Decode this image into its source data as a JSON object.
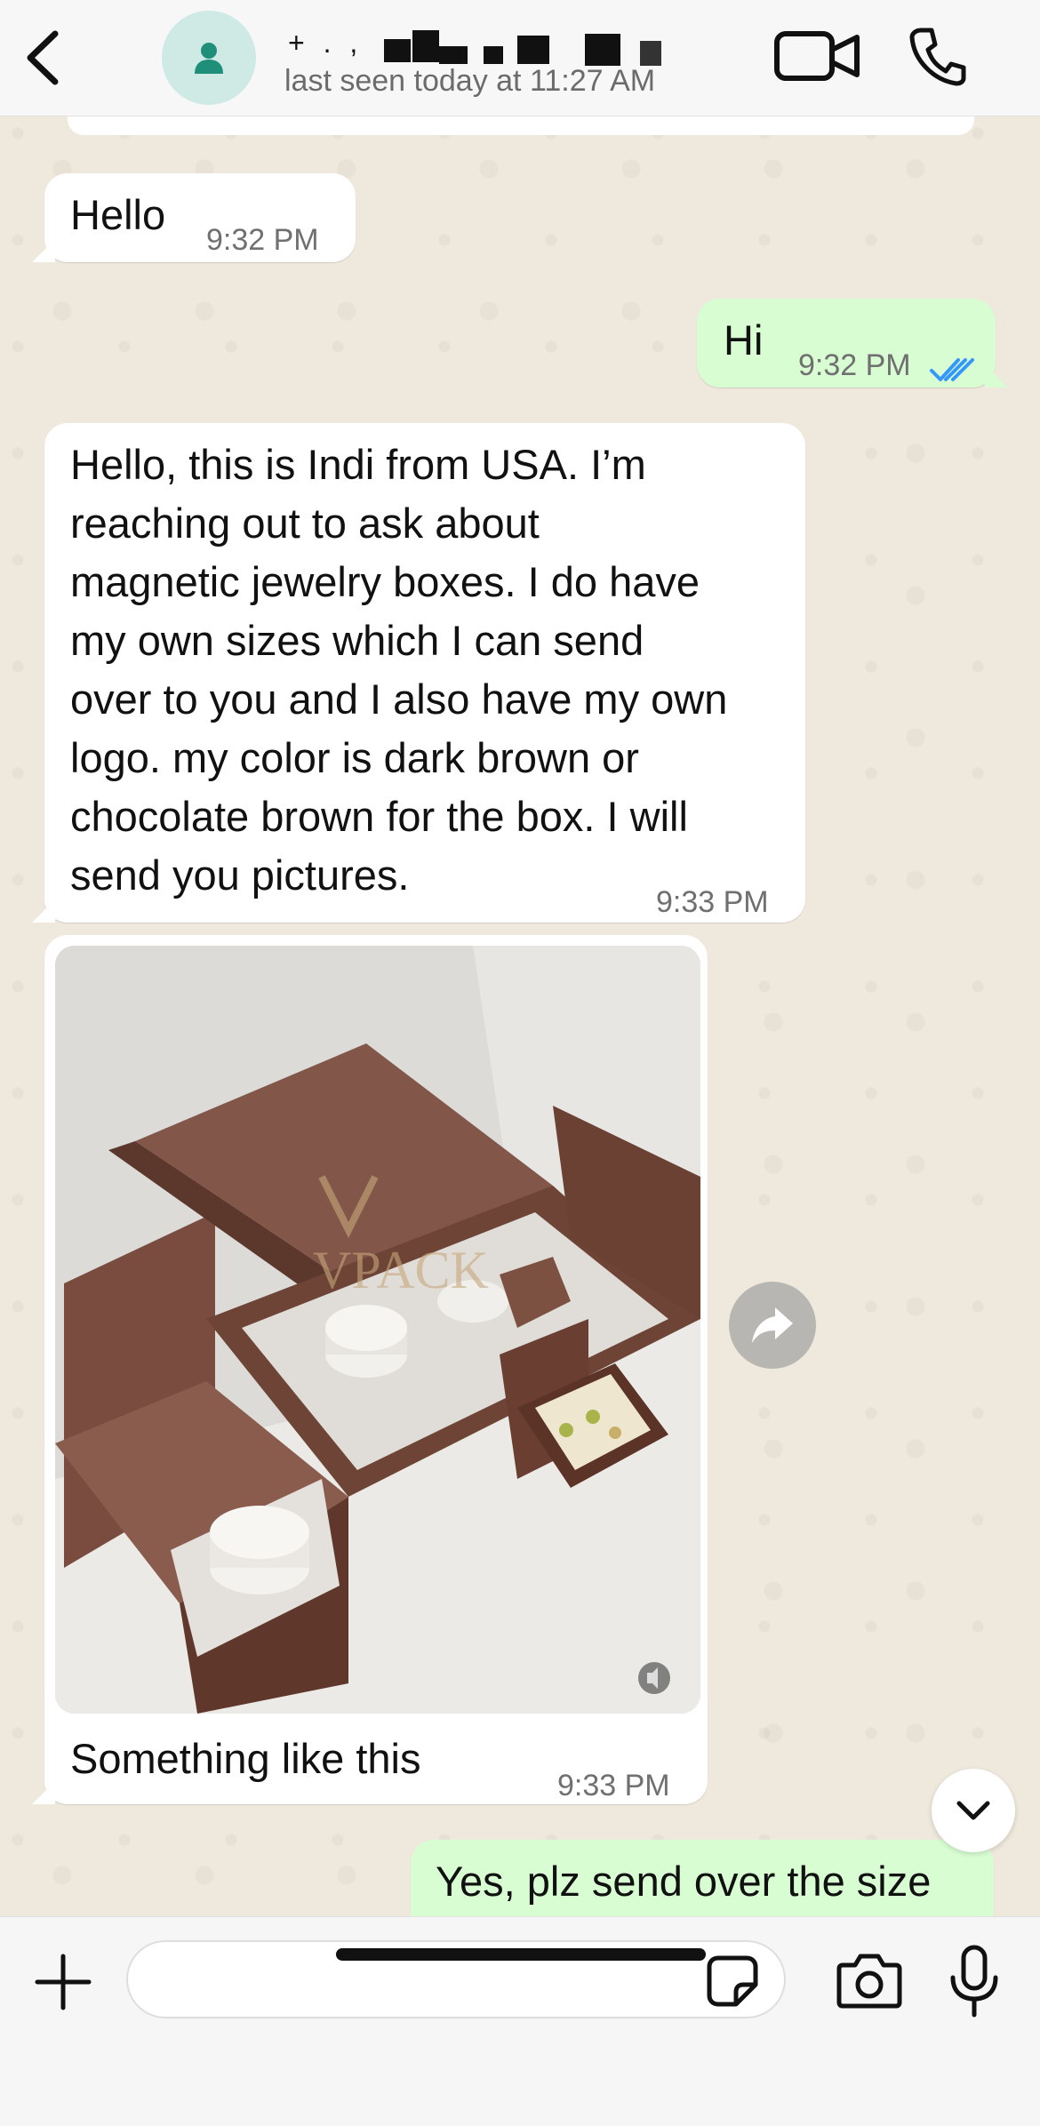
{
  "header": {
    "contact_name": "+ . ,",
    "last_seen": "last seen today at 11:27 AM",
    "icons": [
      "back-chevron-icon",
      "contact-avatar-icon",
      "video-call-icon",
      "voice-call-icon"
    ]
  },
  "messages": [
    {
      "direction": "incoming",
      "text": "Hello",
      "time": "9:32 PM"
    },
    {
      "direction": "outgoing",
      "text": "Hi",
      "time": "9:32 PM",
      "status": "read"
    },
    {
      "direction": "incoming",
      "text": "Hello, this is Indi from USA. I’m\nreaching out to ask about\nmagnetic jewelry boxes. I do have\nmy own sizes which I can send\nover to you and I also have my own\nlogo. my color is dark brown or\nchocolate brown for the box. I will\nsend you pictures.",
      "time": "9:33 PM"
    },
    {
      "direction": "incoming",
      "type": "video",
      "caption": "Something like this",
      "time": "9:33 PM",
      "watermark": "VPACK"
    },
    {
      "direction": "outgoing",
      "text": "Yes, plz send over the size"
    }
  ],
  "composer": {
    "placeholder": "",
    "icons": [
      "plus-icon",
      "sticker-icon",
      "camera-icon",
      "microphone-icon"
    ]
  },
  "colors": {
    "incoming_bubble": "#ffffff",
    "outgoing_bubble": "#d9fdd3",
    "read_ticks": "#3497f9",
    "avatar_bg": "#cfe9e4",
    "avatar_fg": "#1f8f7a"
  }
}
